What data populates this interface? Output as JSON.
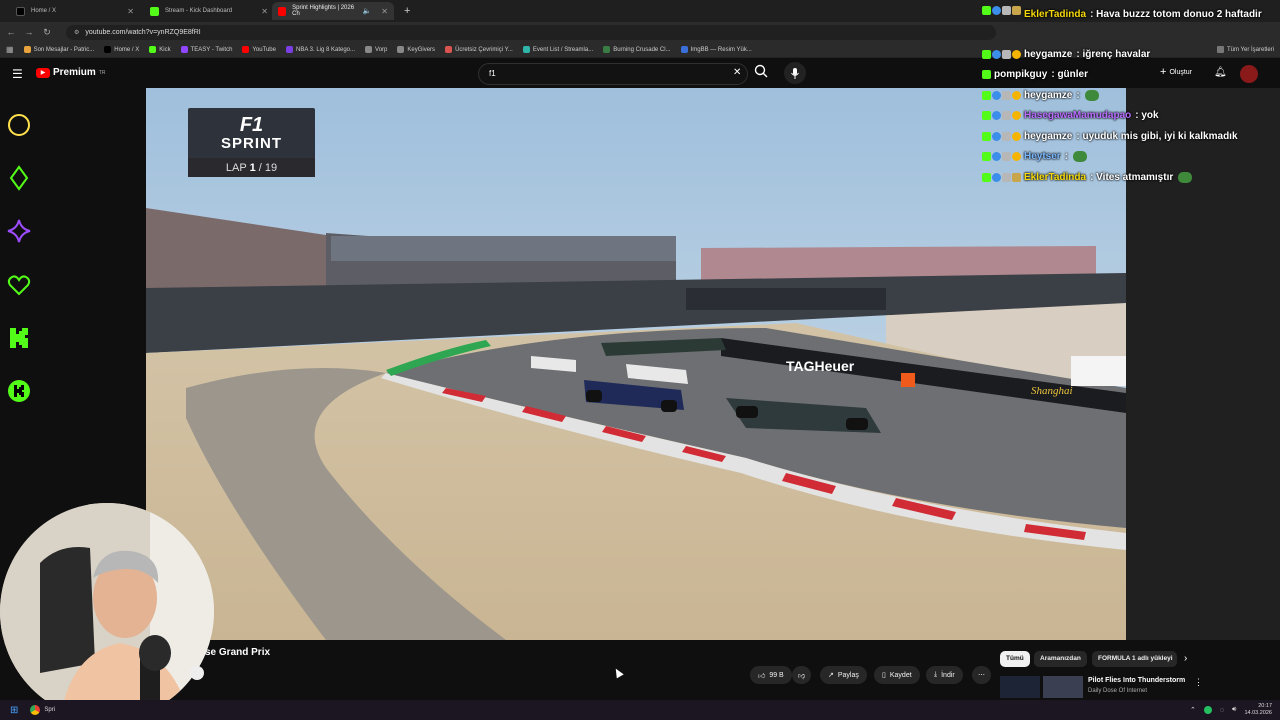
{
  "browser": {
    "tabs": [
      {
        "label": "Home / X",
        "icon": "x-logo-icon",
        "color": "#000000"
      },
      {
        "label": "Stream - Kick Dashboard",
        "icon": "kick-icon",
        "color": "#53fc18"
      },
      {
        "label": "Sprint Highlights | 2026 Ch",
        "icon": "youtube-icon",
        "color": "#ff0000"
      }
    ],
    "new_tab": "+",
    "url": "youtube.com/watch?v=ynRZQ9E8fRI",
    "bookmarks": [
      {
        "label": "Son Mesajlar - Patric...",
        "color": "#e8a33d"
      },
      {
        "label": "Home / X",
        "color": "#000000"
      },
      {
        "label": "Kick",
        "color": "#53fc18"
      },
      {
        "label": "TEASY - Twitch",
        "color": "#9146ff"
      },
      {
        "label": "YouTube",
        "color": "#ff0000"
      },
      {
        "label": "NBA 3. Lig 8 Katego...",
        "color": "#7b3fe4"
      },
      {
        "label": "Vorp",
        "color": "#888888"
      },
      {
        "label": "KeyGivers",
        "color": "#888888"
      },
      {
        "label": "Ücretsiz Çevrimiçi Y...",
        "color": "#d9534f"
      },
      {
        "label": "Event List / Streamla...",
        "color": "#2fb6a8"
      },
      {
        "label": "Burning Crusade Cl...",
        "color": "#3a7d44"
      },
      {
        "label": "ImgBB — Resim Yük...",
        "color": "#3a6fd9"
      }
    ],
    "all_bookmarks": "Tüm Yer İşaretleri"
  },
  "youtube": {
    "logo": "Premium",
    "logo_sup": "TR",
    "search_value": "f1",
    "create_label": "Oluştur",
    "video_title": "se Grand Prix",
    "actions": {
      "like_count": "99 B",
      "share": "Paylaş",
      "save": "Kaydet",
      "download": "İndir"
    },
    "chips": [
      "Tümü",
      "Aramanızdan",
      "FORMULA 1 adlı yükleyi"
    ],
    "recommended": {
      "title": "Pilot Flies Into Thunderstorm",
      "channel": "Daily Dose Of Internet"
    }
  },
  "overlay": {
    "sprint_logo": "F1",
    "sprint_word": "SPRINT",
    "lap_label": "LAP",
    "lap_current": "1",
    "lap_total": "/ 19",
    "banner_brand": "TAGHeuer",
    "track_sign": "Shanghai"
  },
  "chat": [
    {
      "user": "EklerTadinda",
      "color": "#f5d90a",
      "message": "Hava buzzz totom donuo 2 haftadir",
      "badges": [
        "b-k",
        "b-blue",
        "b-sword",
        "b-gold"
      ]
    },
    {
      "user": "heygamze",
      "color": "#ffffff",
      "message": "iğrenç havalar",
      "badges": [
        "b-k",
        "b-blue",
        "b-sword",
        "b-star"
      ]
    },
    {
      "user": "pompikguy",
      "color": "#ffffff",
      "message": "günler",
      "badges": [
        "b-k"
      ]
    },
    {
      "user": "heygamze",
      "color": "#ffffff",
      "message": "",
      "badges": [
        "b-k",
        "b-blue",
        "b-sword",
        "b-star"
      ],
      "emote": true
    },
    {
      "user": "HasegawaMamudapao",
      "color": "#b86dff",
      "message": "yok",
      "badges": [
        "b-k",
        "b-blue",
        "b-sword",
        "b-star"
      ]
    },
    {
      "user": "heygamze",
      "color": "#ffffff",
      "message": "uyuduk mis gibi, iyi ki kalkmadık",
      "badges": [
        "b-k",
        "b-blue",
        "b-sword",
        "b-star"
      ]
    },
    {
      "user": "Heytser",
      "color": "#7ab8ff",
      "message": "",
      "badges": [
        "b-k",
        "b-blue",
        "b-sword",
        "b-star"
      ],
      "emote": true
    },
    {
      "user": "EklerTadinda",
      "color": "#f5d90a",
      "message": "Vites atmamıştır",
      "badges": [
        "b-k",
        "b-blue",
        "b-sword",
        "b-gold"
      ],
      "emote": true
    }
  ],
  "taskbar": {
    "app": "Spri",
    "time": "20:17",
    "date": "14.03.2026"
  },
  "colors": {
    "kick_green": "#53fc18",
    "rail_yellow": "#ffe14d",
    "rail_green": "#53fc18",
    "rail_purple": "#9d4dff",
    "youtube_red": "#ff0000"
  }
}
